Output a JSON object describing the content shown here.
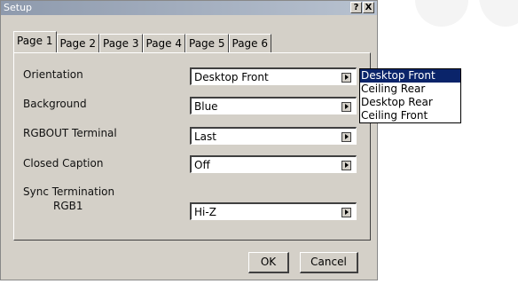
{
  "window": {
    "title": "Setup",
    "help_label": "?",
    "close_label": "X"
  },
  "tabs": [
    {
      "label": "Page 1"
    },
    {
      "label": "Page 2"
    },
    {
      "label": "Page 3"
    },
    {
      "label": "Page 4"
    },
    {
      "label": "Page 5"
    },
    {
      "label": "Page 6"
    }
  ],
  "settings": {
    "orientation": {
      "label": "Orientation",
      "value": "Desktop Front"
    },
    "background": {
      "label": "Background",
      "value": "Blue"
    },
    "rgbout": {
      "label": "RGBOUT Terminal",
      "value": "Last"
    },
    "closed_caption": {
      "label": "Closed Caption",
      "value": "Off"
    },
    "sync_termination": {
      "label": "Sync Termination",
      "sublabel": "RGB1",
      "value": "Hi-Z"
    }
  },
  "orientation_dropdown": {
    "options": [
      "Desktop Front",
      "Ceiling Rear",
      "Desktop Rear",
      "Ceiling Front"
    ],
    "selected_index": 0
  },
  "buttons": {
    "ok_label": "OK",
    "cancel_label": "Cancel"
  }
}
